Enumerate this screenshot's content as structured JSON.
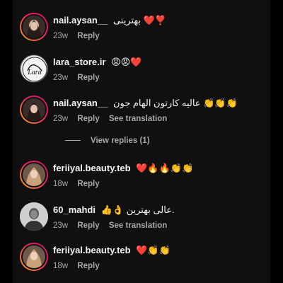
{
  "comments": [
    {
      "username": "nail.aysan__",
      "text": "بهترینی ❤️❣️",
      "time": "23w",
      "reply": "Reply",
      "translation": ""
    },
    {
      "username": "lara_store.ir",
      "text": "😡😡❤️",
      "time": "23w",
      "reply": "Reply",
      "translation": "",
      "avatar_text": "Lara"
    },
    {
      "username": "nail.aysan__",
      "text": "عالیه کارتون الهام جون 👏👏👏",
      "time": "23w",
      "reply": "Reply",
      "translation": "See translation"
    },
    {
      "username": "feriiyal.beauty.teb",
      "text": "❤️🔥🔥👏👏",
      "time": "18w",
      "reply": "Reply",
      "translation": ""
    },
    {
      "username": "60_mahdi",
      "text": "👍👌 عالی بهترین.",
      "time": "23w",
      "reply": "Reply",
      "translation": "See translation"
    },
    {
      "username": "feriiyal.beauty.teb",
      "text": "❤️👏👏",
      "time": "18w",
      "reply": "Reply",
      "translation": ""
    }
  ],
  "view_replies": "View replies (1)",
  "colors": {
    "background": "#101010",
    "text": "#f5f5f5",
    "secondary": "#a8a8a8",
    "ring_start": "#f9a825",
    "ring_end": "#c2185b"
  }
}
